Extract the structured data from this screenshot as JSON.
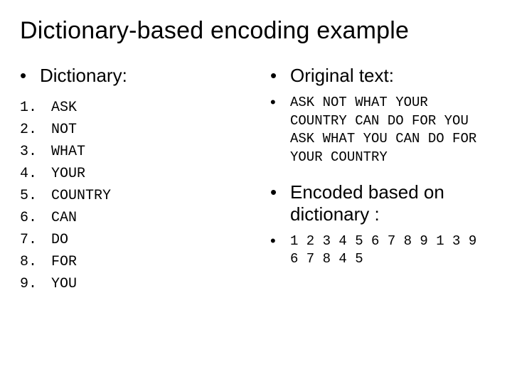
{
  "title": "Dictionary-based encoding example",
  "left": {
    "heading": "Dictionary:",
    "items": [
      {
        "n": "1.",
        "w": "ASK"
      },
      {
        "n": "2.",
        "w": "NOT"
      },
      {
        "n": "3.",
        "w": "WHAT"
      },
      {
        "n": "4.",
        "w": "YOUR"
      },
      {
        "n": "5.",
        "w": "COUNTRY"
      },
      {
        "n": "6.",
        "w": "CAN"
      },
      {
        "n": "7.",
        "w": "DO"
      },
      {
        "n": "8.",
        "w": "FOR"
      },
      {
        "n": "9.",
        "w": "YOU"
      }
    ]
  },
  "right": {
    "heading1": "Original text:",
    "original": "ASK NOT WHAT YOUR COUNTRY CAN DO FOR YOU ASK WHAT YOU CAN DO FOR YOUR COUNTRY",
    "heading2": "Encoded based on dictionary :",
    "encoded": "1 2 3 4 5 6 7 8 9 1 3 9 6 7 8 4 5"
  },
  "glyphs": {
    "bullet": "•"
  }
}
